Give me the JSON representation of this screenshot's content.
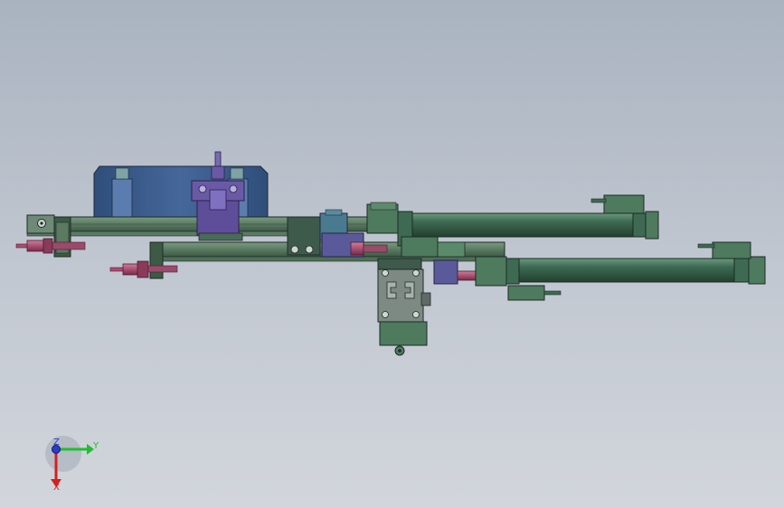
{
  "colors": {
    "frame_green": "#4a6e52",
    "cylinder_green": "#3e6a52",
    "plate_blue": "#3a5a86",
    "gripper_purple": "#6a5aa6",
    "fitting_red": "#b04a72",
    "dark_outline": "#1e2a26"
  },
  "triad": {
    "y_label": "Y",
    "z_label": "Z",
    "x_label": "X",
    "y_color": "#1fbf2f",
    "z_color": "#2a3cc8",
    "x_color": "#d42020"
  }
}
